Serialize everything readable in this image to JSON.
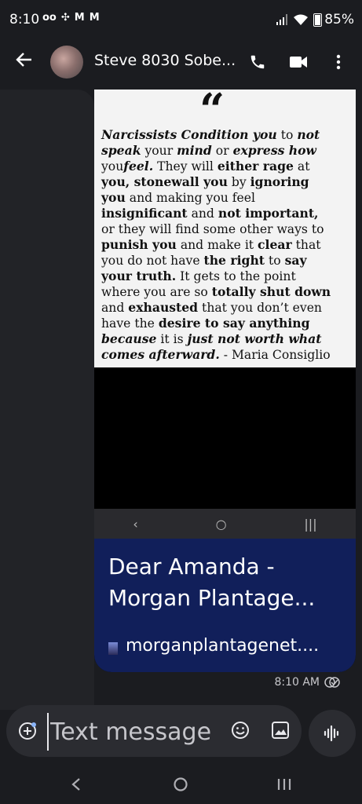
{
  "status_bar": {
    "time": "8:10",
    "notification_icons": [
      "voicemail-icon",
      "pinwheel-icon",
      "gmail-icon",
      "gmail-icon"
    ],
    "battery": "85%",
    "battery_level": 0.85
  },
  "header": {
    "contact_name": "Steve 8030 Sobe...",
    "back_icon": "arrow-left-icon",
    "call_icon": "phone-icon",
    "video_icon": "video-icon",
    "menu_icon": "more-vertical-icon"
  },
  "message": {
    "quote_lines": [
      [
        [
          "Narcissists Condition you",
          "bi"
        ],
        [
          " to ",
          "n"
        ],
        [
          "not",
          "bi"
        ]
      ],
      [
        [
          "speak",
          "bi"
        ],
        [
          " your ",
          "n"
        ],
        [
          "mind",
          "bi"
        ],
        [
          " or ",
          "n"
        ],
        [
          "express how",
          "bi"
        ]
      ],
      [
        [
          "you",
          "n"
        ],
        [
          "feel.",
          "bi"
        ],
        [
          " They will ",
          "n"
        ],
        [
          "either rage",
          "b"
        ],
        [
          " at",
          "n"
        ]
      ],
      [
        [
          "you, stonewall you",
          "b"
        ],
        [
          " by ",
          "n"
        ],
        [
          "ignoring",
          "b"
        ]
      ],
      [
        [
          "you",
          "b"
        ],
        [
          " and making you feel",
          "n"
        ]
      ],
      [
        [
          "insignificant",
          "b"
        ],
        [
          " and ",
          "n"
        ],
        [
          "not important,",
          "b"
        ]
      ],
      [
        [
          "or they will find some other ways to",
          "n"
        ]
      ],
      [
        [
          "punish you",
          "b"
        ],
        [
          " and make it ",
          "n"
        ],
        [
          "clear",
          "b"
        ],
        [
          " that",
          "n"
        ]
      ],
      [
        [
          "you do not have ",
          "n"
        ],
        [
          "the right",
          "b"
        ],
        [
          " to ",
          "n"
        ],
        [
          "say",
          "b"
        ]
      ],
      [
        [
          "your truth.",
          "b"
        ],
        [
          " It gets to the point",
          "n"
        ]
      ],
      [
        [
          "where you are so ",
          "n"
        ],
        [
          "totally shut down",
          "b"
        ]
      ],
      [
        [
          "and ",
          "n"
        ],
        [
          "exhausted",
          "b"
        ],
        [
          " that you don’t even",
          "n"
        ]
      ],
      [
        [
          "have the ",
          "n"
        ],
        [
          "desire to say anything",
          "b"
        ]
      ],
      [
        [
          "because",
          "bi"
        ],
        [
          " it is ",
          "n"
        ],
        [
          "just not worth what",
          "bi"
        ]
      ],
      [
        [
          "comes afterward.",
          "bi"
        ],
        [
          " - Maria Consiglio",
          "n"
        ]
      ]
    ],
    "link_title_line1": "Dear Amanda -",
    "link_title_line2": "Morgan Plantage...",
    "link_domain": "morganplantagenet....",
    "timestamp": "8:10 AM",
    "status_icon": "delivered-check-icon"
  },
  "compose": {
    "placeholder": "Text message",
    "value": "",
    "attach_icon": "add-circle-icon",
    "emoji_icon": "emoji-icon",
    "gallery_icon": "gallery-icon",
    "voice_icon": "voice-waveform-icon"
  },
  "system_nav": {
    "back_icon": "nav-back-icon",
    "home_icon": "nav-home-icon",
    "recents_icon": "nav-recents-icon"
  }
}
